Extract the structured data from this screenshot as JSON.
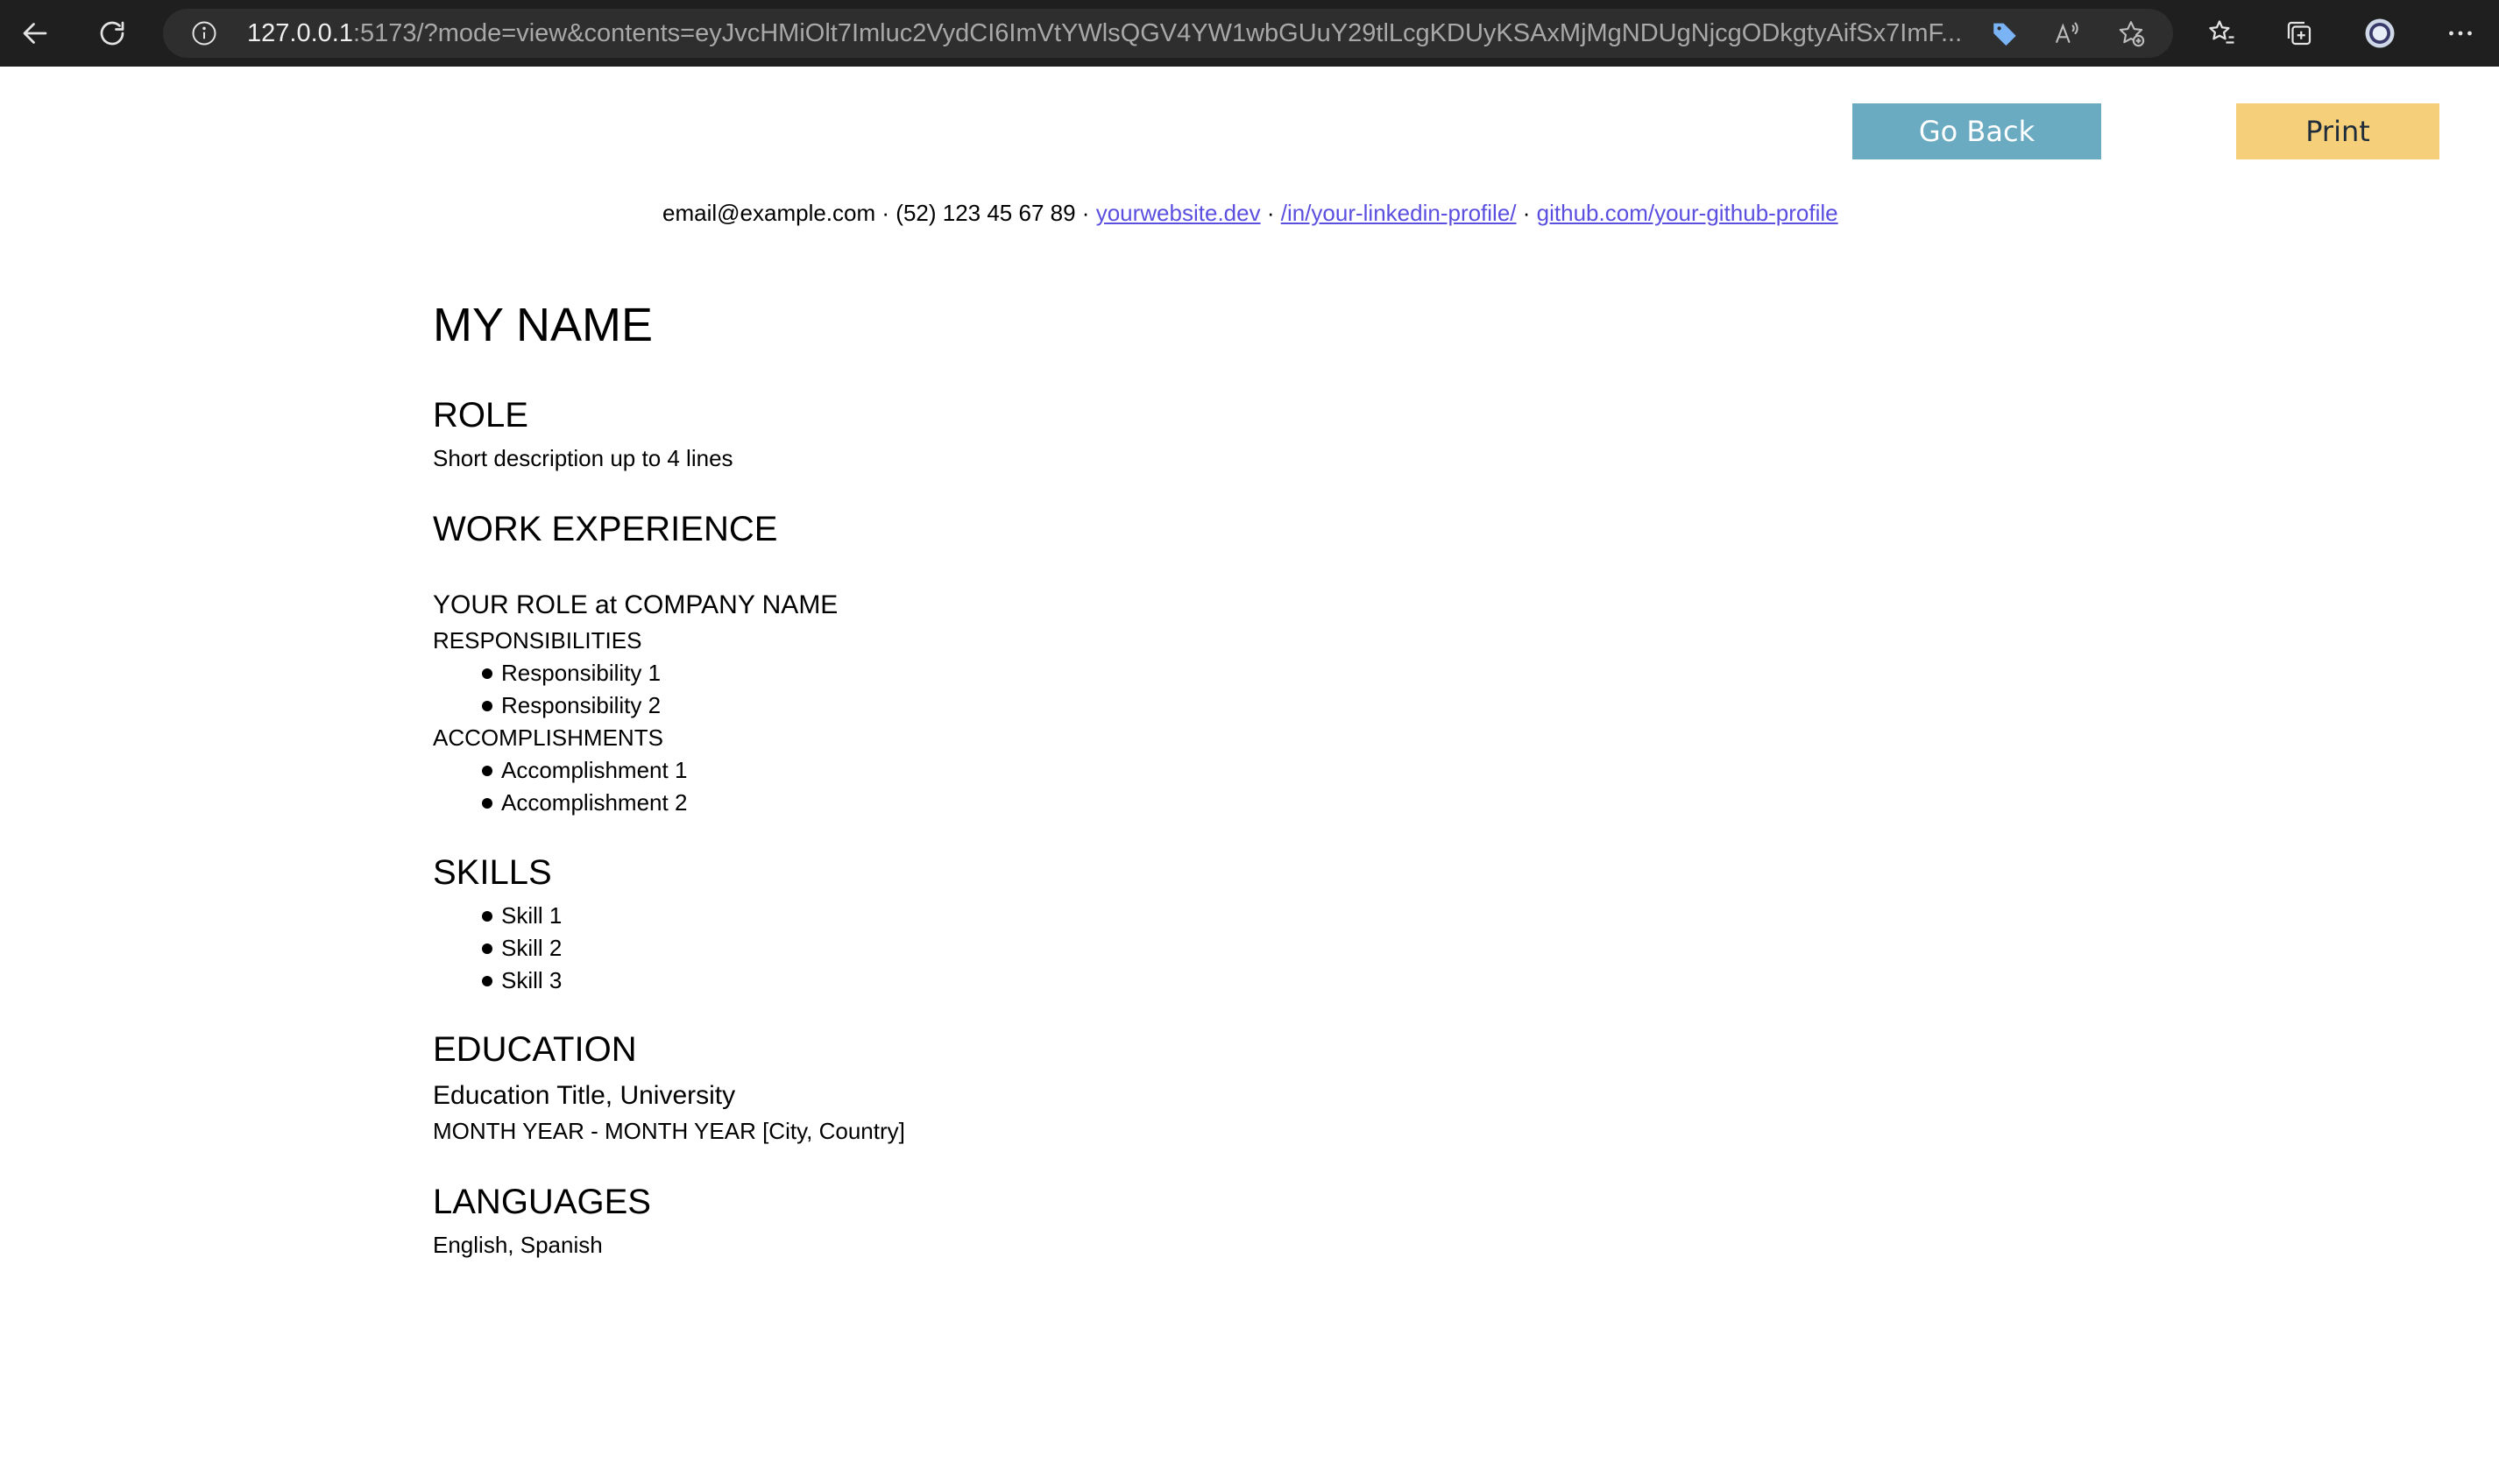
{
  "browser": {
    "url_host": "127.0.0.1",
    "url_rest": ":5173/?mode=view&contents=eyJvcHMiOlt7Imluc2VydCI6ImVtYWlsQGV4YW1wbGUuY29tlLcgKDUyKSAxMjMgNDUgNjcgODkgtyAifSx7ImF..."
  },
  "actions": {
    "go_back_label": "Go Back",
    "print_label": "Print"
  },
  "contact": {
    "email": "email@example.com",
    "phone": "(52) 123 45 67 89",
    "website": "yourwebsite.dev",
    "linkedin": "/in/your-linkedin-profile/",
    "github": "github.com/your-github-profile",
    "separator": "·"
  },
  "resume": {
    "name": "MY NAME",
    "role_title": "ROLE",
    "role_description": "Short description up to 4 lines",
    "work_title": "WORK EXPERIENCE",
    "job_heading": "YOUR ROLE at COMPANY NAME",
    "responsibilities_label": "RESPONSIBILITIES",
    "responsibilities": [
      "Responsibility 1",
      "Responsibility 2"
    ],
    "accomplishments_label": "ACCOMPLISHMENTS",
    "accomplishments": [
      "Accomplishment 1",
      "Accomplishment 2"
    ],
    "skills_title": "SKILLS",
    "skills": [
      "Skill 1",
      "Skill 2",
      "Skill 3"
    ],
    "education_title": "EDUCATION",
    "education_heading": "Education Title, University",
    "education_dates": "MONTH YEAR - MONTH YEAR [City, Country]",
    "languages_title": "LANGUAGES",
    "languages": "English, Spanish"
  }
}
